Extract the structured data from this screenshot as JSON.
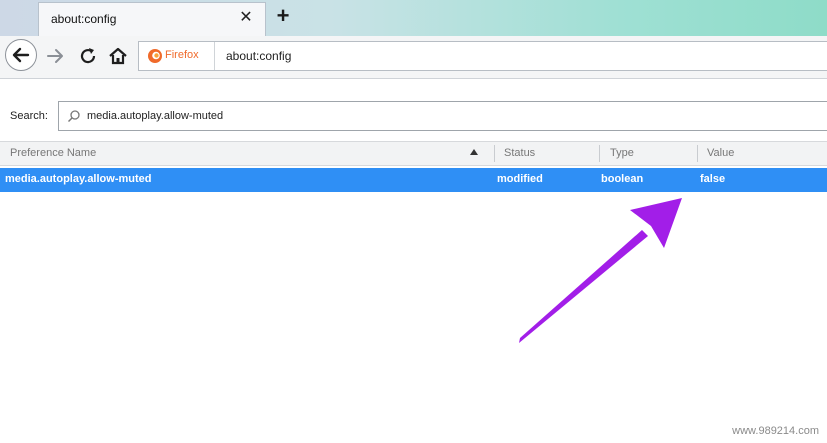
{
  "tab": {
    "title": "about:config",
    "close_glyph": "✕"
  },
  "newtab_glyph": "+",
  "nav": {
    "back_icon": "arrow-left-icon",
    "forward_icon": "arrow-right-icon",
    "reload_icon": "reload-icon",
    "home_icon": "home-icon"
  },
  "urlbar": {
    "identity_label": "Firefox",
    "url": "about:config"
  },
  "search": {
    "label": "Search:",
    "value": "media.autoplay.allow-muted"
  },
  "table": {
    "headers": [
      "Preference Name",
      "Status",
      "Type",
      "Value"
    ],
    "rows": [
      {
        "name": "media.autoplay.allow-muted",
        "status": "modified",
        "type": "boolean",
        "value": "false"
      }
    ]
  },
  "annotation": {
    "arrow_color": "#a21ee8"
  },
  "watermark": "www.989214.com",
  "colors": {
    "selection": "#2f8ff5",
    "firefox_orange": "#f06a2a"
  }
}
